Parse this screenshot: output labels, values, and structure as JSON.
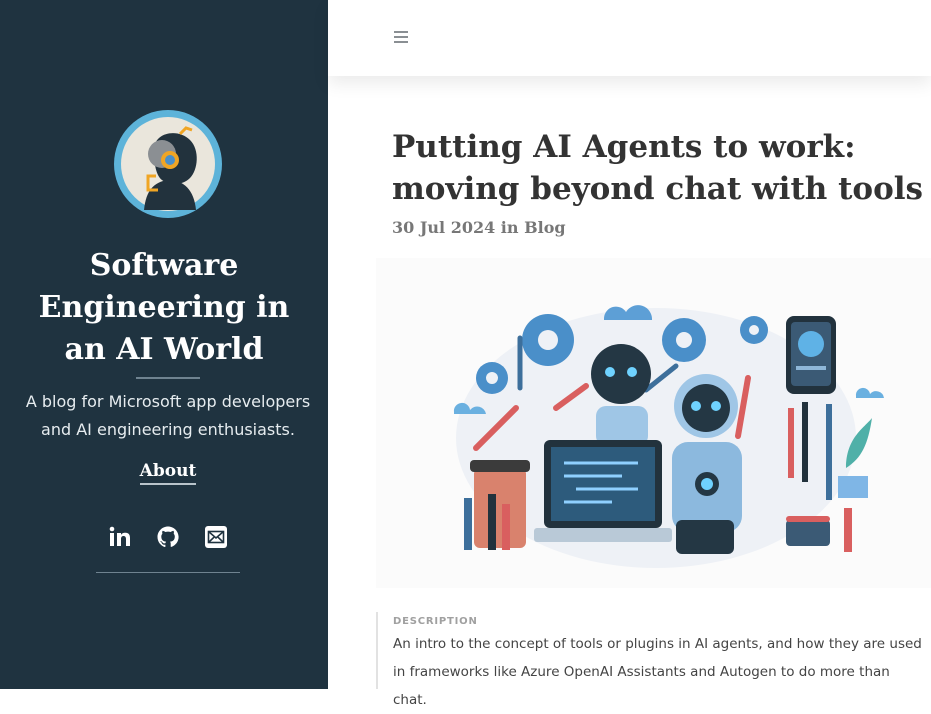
{
  "sidebar": {
    "site_title": "Software Engineering in an AI World",
    "description": "A blog for Microsoft app developers and AI engineering enthusiasts.",
    "about_label": "About",
    "social_icons": [
      "linkedin-icon",
      "github-icon",
      "email-icon"
    ]
  },
  "post": {
    "title": "Putting AI Agents to work: moving beyond chat with tools",
    "date": "30 Jul 2024",
    "in_word": "in",
    "category": "Blog",
    "description_label": "DESCRIPTION",
    "description": "An intro to the concept of tools or plugins in AI agents, and how they are used in frameworks like Azure OpenAI Assistants and Autogen to do more than chat."
  },
  "colors": {
    "sidebar_bg": "#1f3340",
    "accent_blue": "#4a8fc9",
    "accent_orange": "#f0a524"
  }
}
